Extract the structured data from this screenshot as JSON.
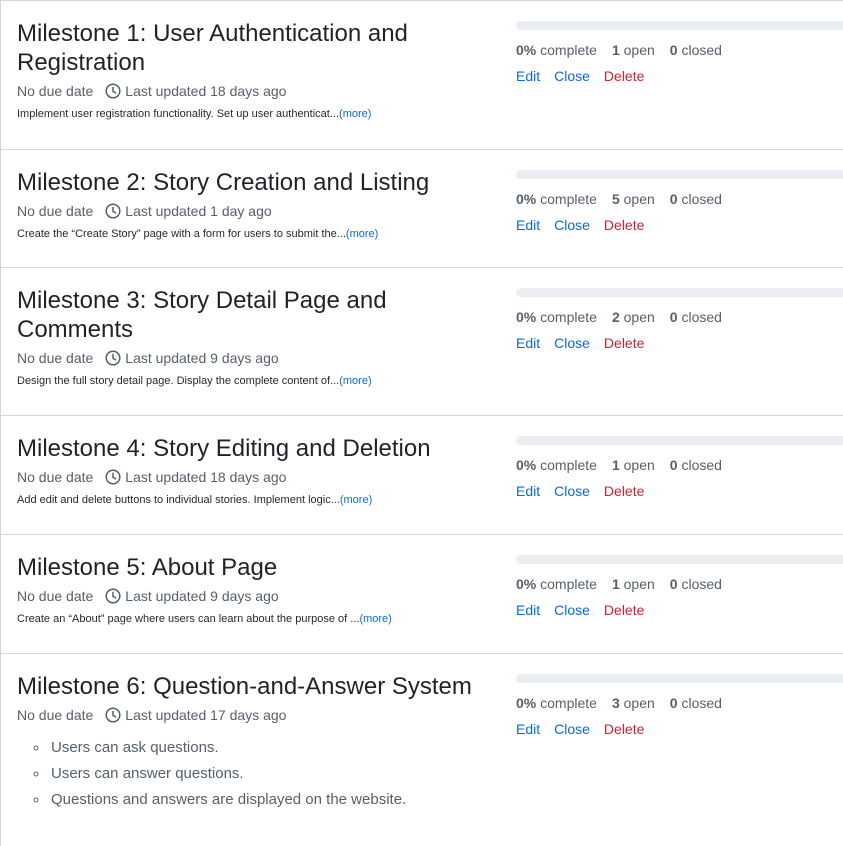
{
  "milestones": [
    {
      "title": "Milestone 1: User Authentication and Registration",
      "due": "No due date",
      "updated": "Last updated 18 days ago",
      "description": "Implement user registration functionality. Set up user authenticat...",
      "more": "(more)",
      "percent": "0%",
      "percent_label": "complete",
      "open_count": "1",
      "open_label": "open",
      "closed_count": "0",
      "closed_label": "closed",
      "progress": 0
    },
    {
      "title": "Milestone 2: Story Creation and Listing",
      "due": "No due date",
      "updated": "Last updated 1 day ago",
      "description": "Create the “Create Story” page with a form for users to submit the...",
      "more": "(more)",
      "percent": "0%",
      "percent_label": "complete",
      "open_count": "5",
      "open_label": "open",
      "closed_count": "0",
      "closed_label": "closed",
      "progress": 0
    },
    {
      "title": "Milestone 3: Story Detail Page and Comments",
      "due": "No due date",
      "updated": "Last updated 9 days ago",
      "description": "Design the full story detail page. Display the complete content of...",
      "more": "(more)",
      "percent": "0%",
      "percent_label": "complete",
      "open_count": "2",
      "open_label": "open",
      "closed_count": "0",
      "closed_label": "closed",
      "progress": 0
    },
    {
      "title": "Milestone 4: Story Editing and Deletion",
      "due": "No due date",
      "updated": "Last updated 18 days ago",
      "description": "Add edit and delete buttons to individual stories. Implement logic...",
      "more": "(more)",
      "percent": "0%",
      "percent_label": "complete",
      "open_count": "1",
      "open_label": "open",
      "closed_count": "0",
      "closed_label": "closed",
      "progress": 0
    },
    {
      "title": "Milestone 5: About Page",
      "due": "No due date",
      "updated": "Last updated 9 days ago",
      "description": "Create an “About” page where users can learn about the purpose of ...",
      "more": "(more)",
      "percent": "0%",
      "percent_label": "complete",
      "open_count": "1",
      "open_label": "open",
      "closed_count": "0",
      "closed_label": "closed",
      "progress": 0
    },
    {
      "title": "Milestone 6: Question-and-Answer System",
      "due": "No due date",
      "updated": "Last updated 17 days ago",
      "bullets": [
        "Users can ask questions.",
        "Users can answer questions.",
        "Questions and answers are displayed on the website."
      ],
      "percent": "0%",
      "percent_label": "complete",
      "open_count": "3",
      "open_label": "open",
      "closed_count": "0",
      "closed_label": "closed",
      "progress": 0
    }
  ],
  "actions": {
    "edit": "Edit",
    "close": "Close",
    "delete": "Delete"
  },
  "icons": {
    "updated_icon": "clock-icon"
  },
  "colors": {
    "link": "#0969da",
    "danger": "#cf222e",
    "progress_track": "#eaeef2",
    "progress_fill": "#1f883d"
  }
}
